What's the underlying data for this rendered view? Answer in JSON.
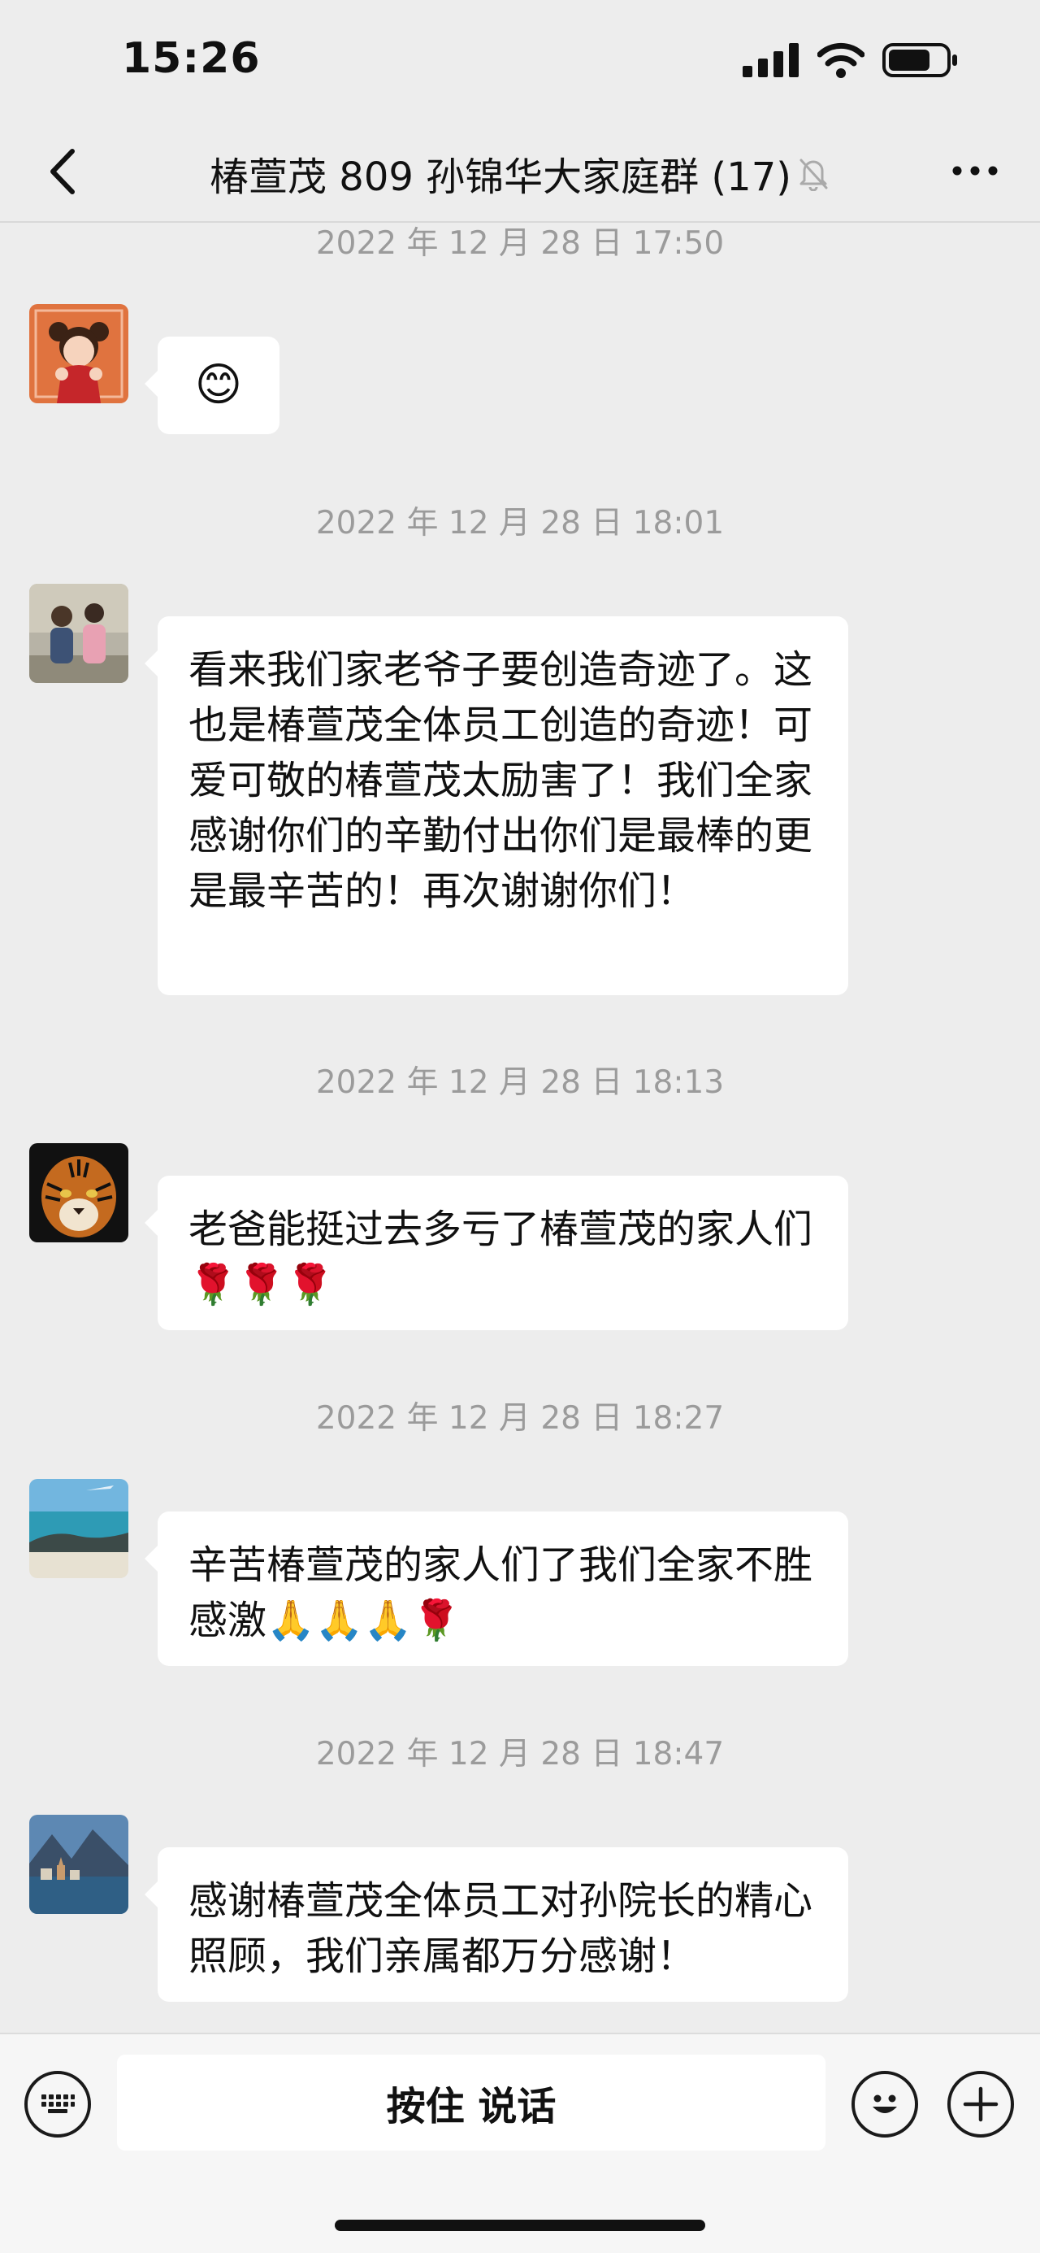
{
  "status_bar": {
    "time": "15:26"
  },
  "header": {
    "back_icon": "chevron-left-icon",
    "title": "椿萱茂 809 孙锦华大家庭群 (17)",
    "muted_icon": "bell-off-icon",
    "more_icon": "more-dots-icon"
  },
  "messages": [
    {
      "timestamp": "2022 年 12 月 28 日 17:50",
      "avatar": "cartoon-girl-avatar",
      "text": "😊"
    },
    {
      "timestamp": "2022 年 12 月 28 日 18:01",
      "avatar": "family-photo-avatar",
      "text": "看来我们家老爷子要创造奇迹了。这也是椿萱茂全体员工创造的奇迹！可爱可敬的椿萱茂太励害了！我们全家感谢你们的辛勤付出你们是最棒的更是最辛苦的！再次谢谢你们！"
    },
    {
      "timestamp": "2022 年 12 月 28 日 18:13",
      "avatar": "tiger-avatar",
      "text": "老爸能挺过去多亏了椿萱茂的家人们🌹🌹🌹"
    },
    {
      "timestamp": "2022 年 12 月 28 日 18:27",
      "avatar": "seaside-avatar",
      "text": "辛苦椿萱茂的家人们了我们全家不胜感激🙏🙏🙏🌹"
    },
    {
      "timestamp": "2022 年 12 月 28 日 18:47",
      "avatar": "lake-town-avatar",
      "text": "感谢椿萱茂全体员工对孙院长的精心照顾，我们亲属都万分感谢！"
    }
  ],
  "input_bar": {
    "voice_label": "按住 说话",
    "keyboard_icon": "keyboard-icon",
    "emoji_icon": "emoji-icon",
    "plus_icon": "plus-icon"
  }
}
